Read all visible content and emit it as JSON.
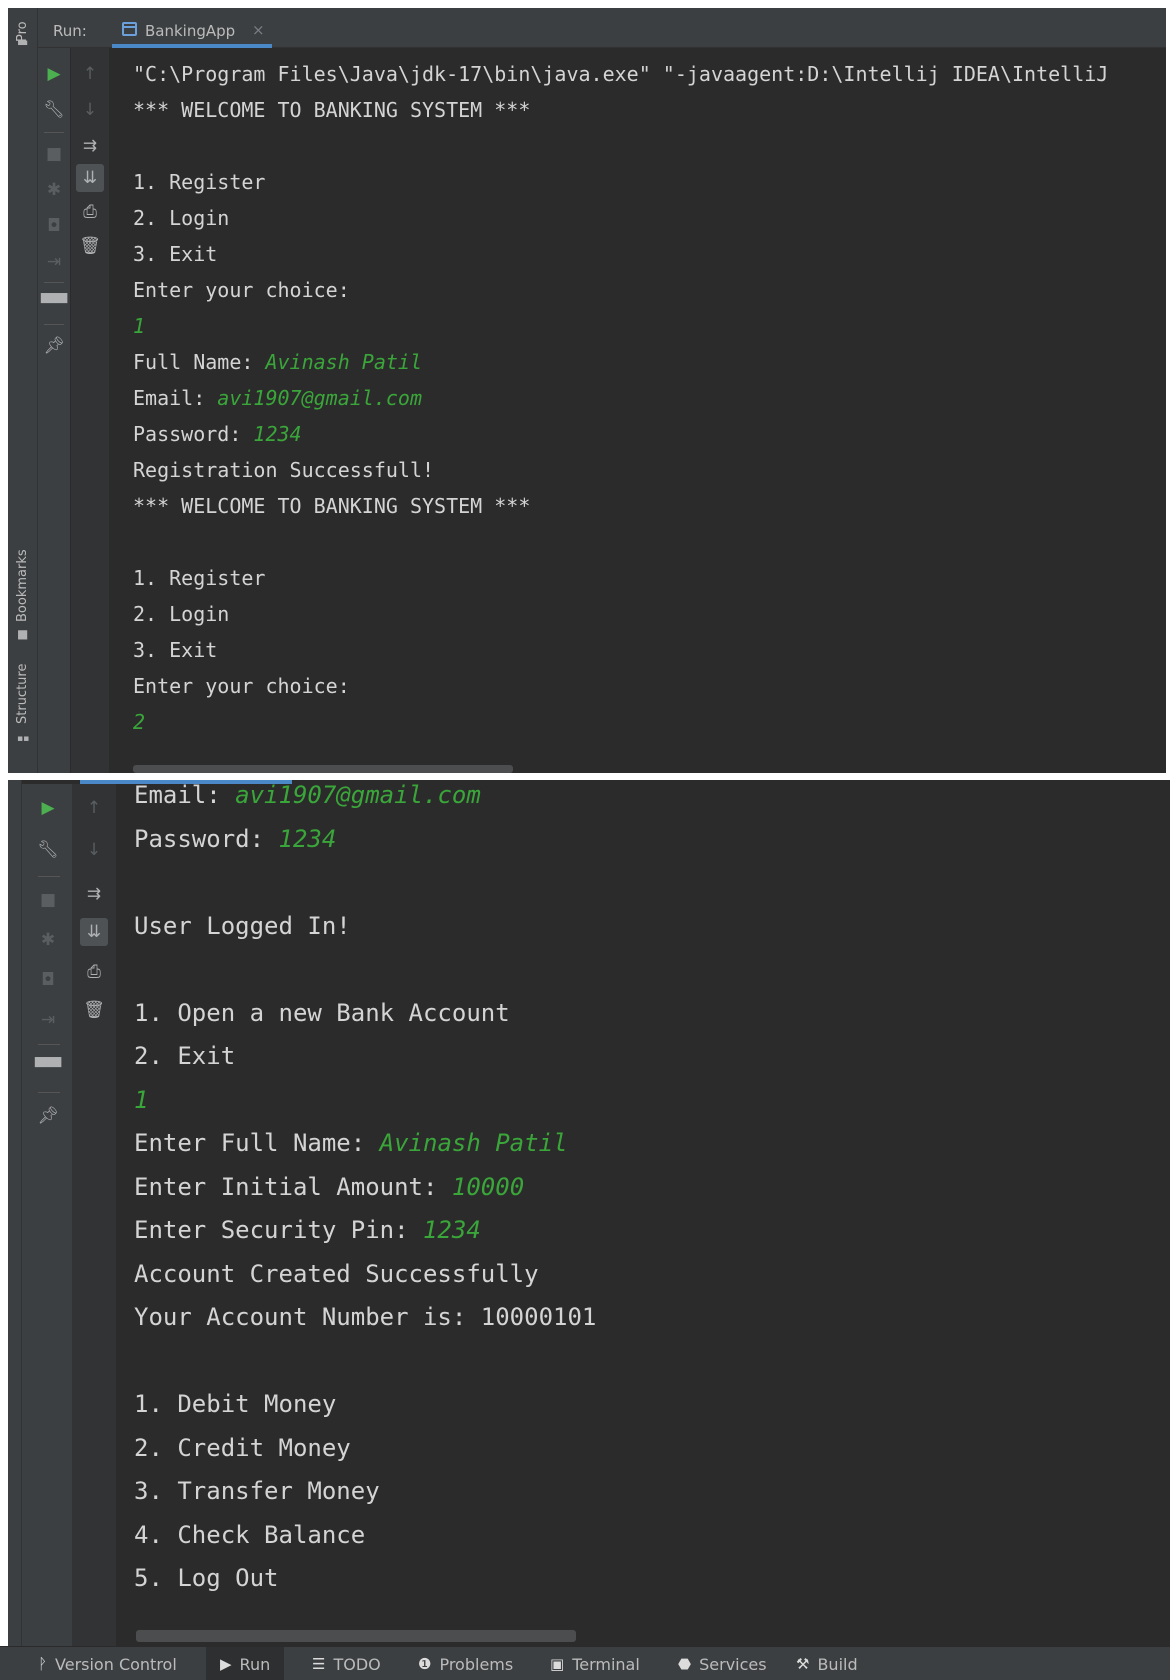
{
  "top_window": {
    "left_strip": {
      "project_label": "Pro",
      "bookmarks_label": "Bookmarks",
      "structure_label": "Structure"
    },
    "header": {
      "run_label": "Run:",
      "tab_label": "BankingApp",
      "tab_close": "×"
    },
    "console_lines": [
      {
        "text": "\"C:\\Program Files\\Java\\jdk-17\\bin\\java.exe\" \"-javaagent:D:\\Intellij IDEA\\IntelliJ"
      },
      {
        "text": "*** WELCOME TO BANKING SYSTEM ***"
      },
      {
        "text": ""
      },
      {
        "text": "1. Register"
      },
      {
        "text": "2. Login"
      },
      {
        "text": "3. Exit"
      },
      {
        "text": "Enter your choice:"
      },
      {
        "text": "",
        "input": "1"
      },
      {
        "text": "Full Name: ",
        "input": "Avinash Patil"
      },
      {
        "text": "Email: ",
        "input": "avi1907@gmail.com"
      },
      {
        "text": "Password: ",
        "input": "1234"
      },
      {
        "text": "Registration Successfull!"
      },
      {
        "text": "*** WELCOME TO BANKING SYSTEM ***"
      },
      {
        "text": ""
      },
      {
        "text": "1. Register"
      },
      {
        "text": "2. Login"
      },
      {
        "text": "3. Exit"
      },
      {
        "text": "Enter your choice:"
      },
      {
        "text": "",
        "input": "2"
      }
    ]
  },
  "bottom_window": {
    "console_lines": [
      {
        "text": "Email: ",
        "input": "avi1907@gmail.com"
      },
      {
        "text": "Password: ",
        "input": "1234"
      },
      {
        "text": ""
      },
      {
        "text": "User Logged In!"
      },
      {
        "text": ""
      },
      {
        "text": "1. Open a new Bank Account"
      },
      {
        "text": "2. Exit"
      },
      {
        "text": "",
        "input": "1"
      },
      {
        "text": "Enter Full Name: ",
        "input": "Avinash Patil"
      },
      {
        "text": "Enter Initial Amount: ",
        "input": "10000"
      },
      {
        "text": "Enter Security Pin: ",
        "input": "1234"
      },
      {
        "text": "Account Created Successfully"
      },
      {
        "text": "Your Account Number is: 10000101"
      },
      {
        "text": ""
      },
      {
        "text": "1. Debit Money"
      },
      {
        "text": "2. Credit Money"
      },
      {
        "text": "3. Transfer Money"
      },
      {
        "text": "4. Check Balance"
      },
      {
        "text": "5. Log Out"
      }
    ]
  },
  "status_bar": {
    "version_control": "Version Control",
    "run": "Run",
    "todo": "TODO",
    "problems": "Problems",
    "terminal": "Terminal",
    "services": "Services",
    "build": "Build"
  },
  "colors": {
    "background": "#2b2b2b",
    "panel": "#3c3f41",
    "console_text": "#d4d4d4",
    "user_input": "#3aa63a",
    "run_green": "#4caf50",
    "tab_accent": "#4a88c7"
  }
}
